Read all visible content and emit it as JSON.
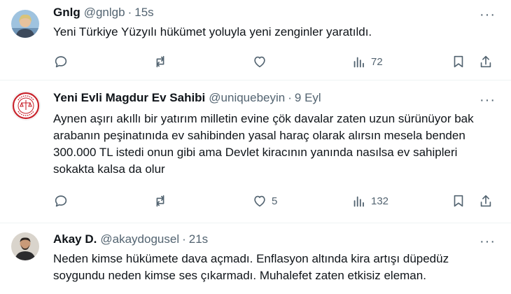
{
  "tweets": [
    {
      "name": "Gnlg",
      "handle": "@gnlgb",
      "time": "15s",
      "text": "Yeni Türkiye Yüzyılı hükümet yoluyla yeni zenginler yaratıldı.",
      "likes": "",
      "views": "72",
      "avatar": "woman-photo-avatar"
    },
    {
      "name": "Yeni Evli Magdur Ev Sahibi",
      "handle": "@uniquebeyin",
      "time": "9 Eyl",
      "text": "Aynen aşırı akıllı bir yatırım milletin evine çök davalar zaten uzun sürünüyor bak arabanın peşinatınıda ev sahibinden yasal haraç olarak alırsın mesela benden 300.000 TL istedi onun gibi ama Devlet kiracının yanında nasılsa ev sahipleri sokakta kalsa da olur",
      "likes": "5",
      "views": "132",
      "avatar": "red-seal-logo-avatar"
    },
    {
      "name": "Akay D.",
      "handle": "@akaydogusel",
      "time": "21s",
      "text": "Neden kimse hükümete dava açmadı. Enflasyon altında kira artışı düpedüz soygundu neden kimse ses çıkarmadı. Muhalefet zaten etkisiz eleman.",
      "likes": "",
      "views": "",
      "avatar": "man-photo-avatar"
    }
  ],
  "separator": "·",
  "more_label": "···",
  "colors": {
    "text": "#0f1419",
    "muted": "#536471",
    "border": "#eff3f4",
    "seal_red": "#c8232c"
  }
}
